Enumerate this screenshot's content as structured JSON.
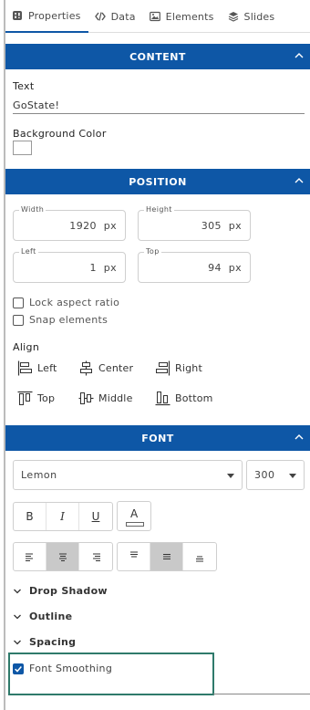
{
  "tabs": [
    {
      "label": "Properties",
      "icon": "properties-icon",
      "active": true
    },
    {
      "label": "Data",
      "icon": "code-icon",
      "active": false
    },
    {
      "label": "Elements",
      "icon": "image-icon",
      "active": false
    },
    {
      "label": "Slides",
      "icon": "layers-icon",
      "active": false
    }
  ],
  "content": {
    "header": "CONTENT",
    "text_label": "Text",
    "text_value": "GoState!",
    "bg_label": "Background Color",
    "bg_color": "#ffffff"
  },
  "position": {
    "header": "POSITION",
    "width": {
      "label": "Width",
      "value": "1920",
      "unit": "px"
    },
    "height": {
      "label": "Height",
      "value": "305",
      "unit": "px"
    },
    "left": {
      "label": "Left",
      "value": "1",
      "unit": "px"
    },
    "top": {
      "label": "Top",
      "value": "94",
      "unit": "px"
    },
    "lock_aspect": "Lock aspect ratio",
    "snap": "Snap elements",
    "align_label": "Align",
    "align": {
      "left": "Left",
      "center": "Center",
      "right": "Right",
      "top": "Top",
      "middle": "Middle",
      "bottom": "Bottom"
    }
  },
  "font": {
    "header": "FONT",
    "family": "Lemon",
    "weight": "300",
    "bold": "B",
    "italic": "I",
    "underline": "U",
    "color_letter": "A",
    "drop_shadow": "Drop Shadow",
    "outline": "Outline",
    "spacing": "Spacing",
    "font_smoothing": "Font Smoothing",
    "font_smoothing_checked": true
  },
  "colors": {
    "accent": "#0e57a6",
    "highlight": "#2f7a6b",
    "selected_button": "#c9c9c9"
  }
}
